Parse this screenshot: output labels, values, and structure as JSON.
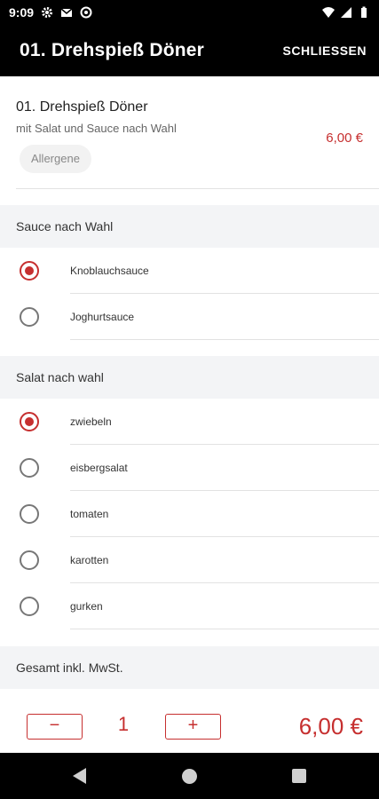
{
  "status_bar": {
    "time": "9:09",
    "icons": [
      "gear-icon",
      "gmail-icon",
      "settings-icon",
      "wifi-icon",
      "signal-icon",
      "battery-icon"
    ]
  },
  "app_bar": {
    "title": "01. Drehspieß Döner",
    "close_label": "SCHLIESSEN"
  },
  "product": {
    "name": "01. Drehspieß Döner",
    "description": "mit Salat und Sauce nach Wahl",
    "price": "6,00 €",
    "allergen_label": "Allergene"
  },
  "sections": [
    {
      "title": "Sauce nach Wahl",
      "options": [
        {
          "label": "Knoblauchsauce",
          "selected": true
        },
        {
          "label": "Joghurtsauce",
          "selected": false
        }
      ]
    },
    {
      "title": "Salat nach wahl",
      "options": [
        {
          "label": "zwiebeln",
          "selected": true
        },
        {
          "label": "eisbergsalat",
          "selected": false
        },
        {
          "label": "tomaten",
          "selected": false
        },
        {
          "label": "karotten",
          "selected": false
        },
        {
          "label": "gurken",
          "selected": false
        }
      ]
    }
  ],
  "total": {
    "header": "Gesamt inkl. MwSt.",
    "quantity": "1",
    "minus_label": "−",
    "plus_label": "+",
    "price": "6,00 €"
  },
  "colors": {
    "accent": "#c62f2f",
    "bar": "#000000",
    "section_bg": "#f3f4f6"
  }
}
